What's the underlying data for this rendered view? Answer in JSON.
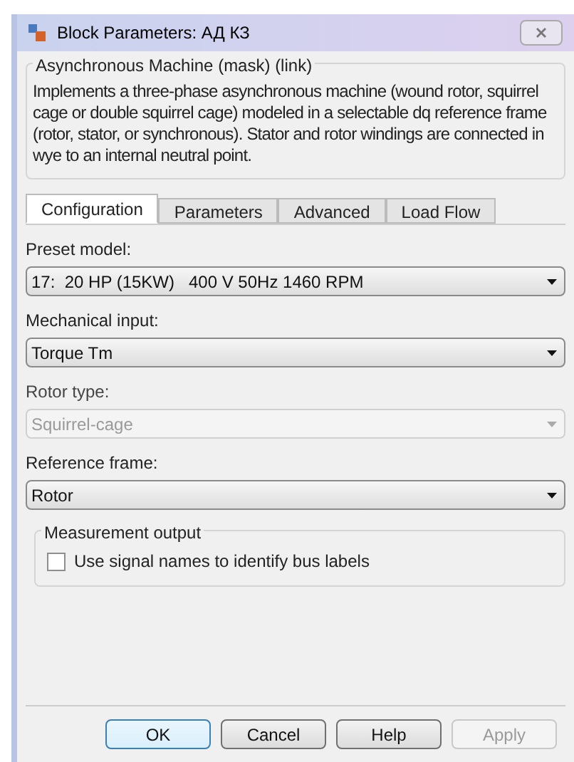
{
  "window": {
    "title": "Block Parameters: АД КЗ"
  },
  "mask": {
    "title": "Asynchronous Machine (mask) (link)",
    "description": "Implements a three-phase asynchronous machine (wound rotor, squirrel cage or double squirrel cage) modeled in a selectable dq reference frame (rotor, stator, or synchronous). Stator and rotor windings are connected in wye to an internal neutral point."
  },
  "tabs": [
    {
      "label": "Configuration",
      "selected": true
    },
    {
      "label": "Parameters",
      "selected": false
    },
    {
      "label": "Advanced",
      "selected": false
    },
    {
      "label": "Load Flow",
      "selected": false
    }
  ],
  "fields": [
    {
      "label": "Preset model:",
      "value": "17:  20 HP (15KW)   400 V 50Hz 1460 RPM",
      "disabled": false
    },
    {
      "label": "Mechanical input:",
      "value": "Torque Tm",
      "disabled": false
    },
    {
      "label": "Rotor type:",
      "value": "Squirrel-cage",
      "disabled": true
    },
    {
      "label": "Reference frame:",
      "value": "Rotor",
      "disabled": false
    }
  ],
  "measurement": {
    "title": "Measurement output",
    "checkbox": {
      "label": "Use signal names to identify bus labels",
      "checked": false
    }
  },
  "buttons": [
    {
      "label": "OK",
      "default": true,
      "disabled": false
    },
    {
      "label": "Cancel",
      "default": false,
      "disabled": false
    },
    {
      "label": "Help",
      "default": false,
      "disabled": false
    },
    {
      "label": "Apply",
      "default": false,
      "disabled": true
    }
  ]
}
